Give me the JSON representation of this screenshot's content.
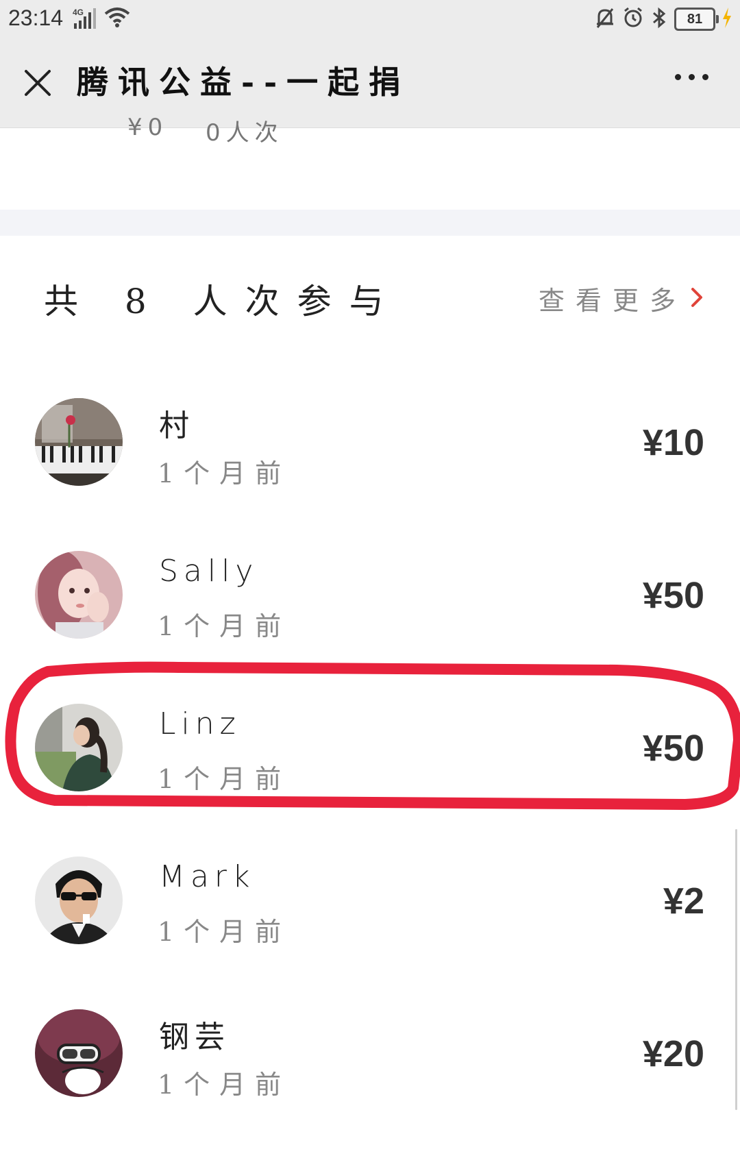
{
  "status_bar": {
    "time": "23:14",
    "network": "4G",
    "battery": "81"
  },
  "title_bar": {
    "title": "腾讯公益--一起捐"
  },
  "cropped_text": [
    "¥0",
    "0人次"
  ],
  "participants": {
    "summary": "共 8 人次参与",
    "view_more": "查看更多"
  },
  "donors": [
    {
      "name": "村",
      "time": "1个月前",
      "amount": "¥10",
      "avatar": "piano-avatar"
    },
    {
      "name": "Sally",
      "time": "1个月前",
      "amount": "¥50",
      "avatar": "girl-avatar"
    },
    {
      "name": "Linz",
      "time": "1个月前",
      "amount": "¥50",
      "avatar": "woman-avatar",
      "highlighted": true
    },
    {
      "name": "Mark",
      "time": "1个月前",
      "amount": "¥2",
      "avatar": "man-sunglasses-avatar"
    },
    {
      "name": "钢芸",
      "time": "1个月前",
      "amount": "¥20",
      "avatar": "helmet-avatar"
    }
  ],
  "colors": {
    "highlight": "#e8223c",
    "chevron": "#e0443a",
    "header_bg": "#ececec"
  }
}
